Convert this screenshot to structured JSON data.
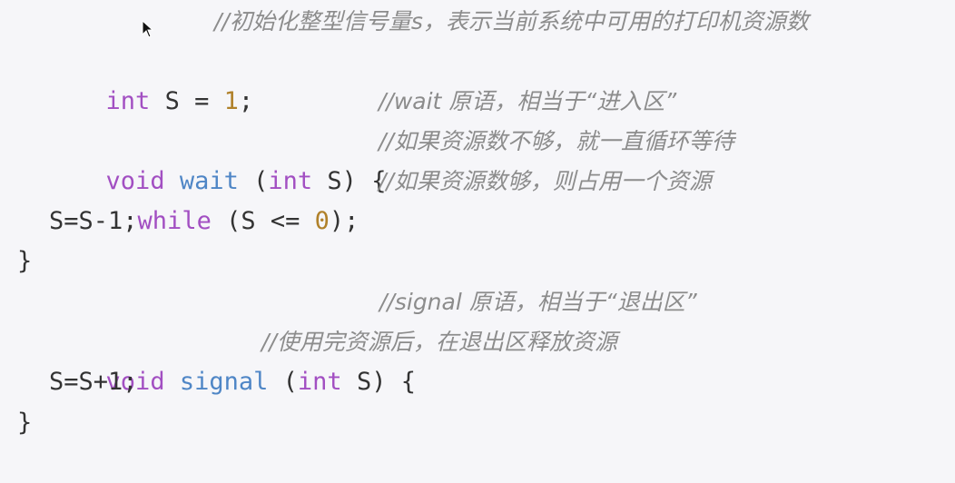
{
  "code": {
    "line1": {
      "kw": "int",
      "var": " S = ",
      "num": "1",
      "end": ";",
      "comment": "//初始化整型信号量s，表示当前系统中可用的打印机资源数"
    },
    "line2": {
      "kw": "void",
      "fn": "wait",
      "open": " (",
      "kw2": "int",
      "rest": " S) {",
      "comment": "//wait 原语，相当于“进入区”"
    },
    "line3": {
      "kw": "while",
      "mid": " (S <= ",
      "num": "0",
      "end": ");",
      "comment": "//如果资源数不够，就一直循环等待"
    },
    "line4": {
      "text": "S=S-1;",
      "comment": "//如果资源数够，则占用一个资源"
    },
    "line5": {
      "text": "}"
    },
    "line6": {
      "kw": "void",
      "fn": "signal",
      "open": " (",
      "kw2": "int",
      "rest": " S) {",
      "comment": "//signal 原语，相当于“退出区”"
    },
    "line7": {
      "text": "S=S+1;",
      "comment": "//使用完资源后，在退出区释放资源"
    },
    "line8": {
      "text": "}"
    }
  },
  "colors": {
    "keyword": "#a24fc2",
    "function": "#4f86c6",
    "number": "#b0812a",
    "comment": "#8c8c8c",
    "background": "#f6f6f9"
  },
  "icons": {
    "pointer": "mouse-pointer-icon"
  }
}
